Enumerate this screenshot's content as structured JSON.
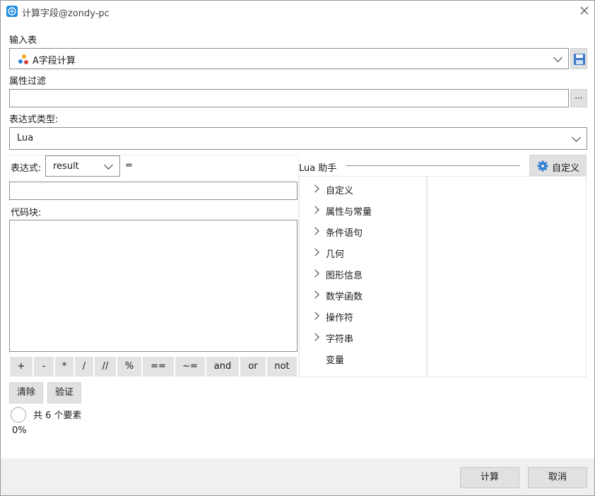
{
  "window": {
    "title": "计算字段@zondy-pc"
  },
  "input_table": {
    "label": "输入表",
    "value": "A字段计算"
  },
  "attribute_filter": {
    "label": "属性过滤",
    "value": "",
    "browse_label": "···"
  },
  "expression_type": {
    "label": "表达式类型:",
    "value": "Lua"
  },
  "expression": {
    "label": "表达式:",
    "target": "result",
    "equals": "=",
    "value": ""
  },
  "code_block": {
    "label": "代码块:",
    "value": ""
  },
  "operators": [
    "+",
    "-",
    "*",
    "/",
    "//",
    "%",
    "==",
    "~=",
    "and",
    "or",
    "not"
  ],
  "actions": {
    "clear": "清除",
    "verify": "验证"
  },
  "status": {
    "count_text": "共 6 个要素",
    "progress_text": "0%",
    "progress": 0
  },
  "lua_helper": {
    "title": "Lua 助手",
    "custom_button": "自定义",
    "tree": [
      {
        "label": "自定义",
        "expandable": true
      },
      {
        "label": "属性与常量",
        "expandable": true
      },
      {
        "label": "条件语句",
        "expandable": true
      },
      {
        "label": "几何",
        "expandable": true
      },
      {
        "label": "图形信息",
        "expandable": true
      },
      {
        "label": "数学函数",
        "expandable": true
      },
      {
        "label": "操作符",
        "expandable": true
      },
      {
        "label": "字符串",
        "expandable": true
      },
      {
        "label": "变量",
        "expandable": false
      }
    ]
  },
  "footer": {
    "compute": "计算",
    "cancel": "取消"
  },
  "colors": {
    "accent": "#1f8ee0",
    "button": "#e1e1e1",
    "border": "#8c8c8c"
  },
  "icons": {
    "app": "app-icon",
    "close": "close-icon",
    "layer": "layer-icon",
    "save": "save-icon",
    "gear": "gear-icon"
  }
}
